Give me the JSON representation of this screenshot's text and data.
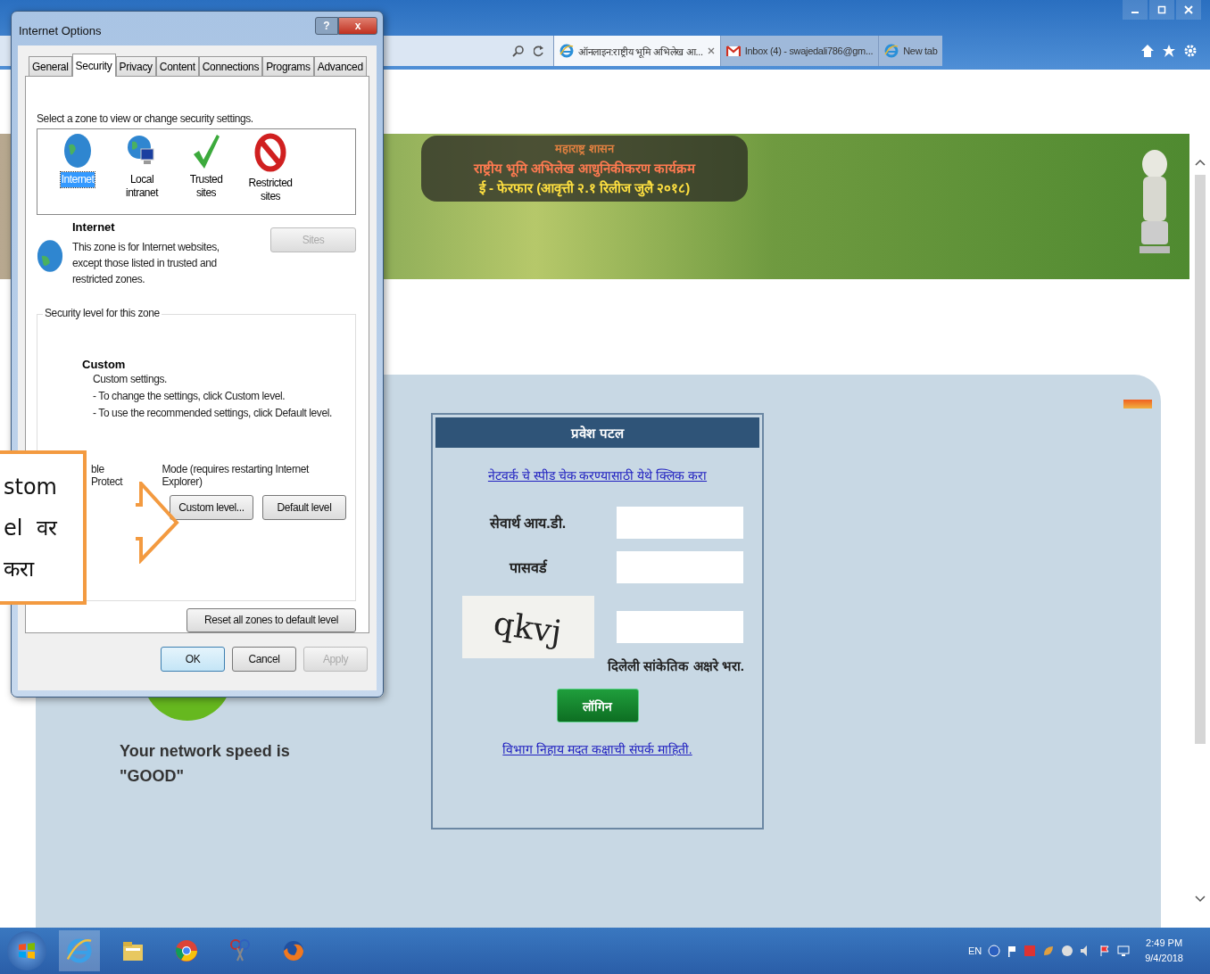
{
  "browser": {
    "tabs": [
      {
        "label": "ऑनलाइन:राष्ट्रीय भूमि अभिलेख आ...",
        "selected": true,
        "kind": "ie",
        "closable": true
      },
      {
        "label": "Inbox (4) - swajedali786@gm...",
        "selected": false,
        "kind": "mail",
        "closable": false
      },
      {
        "label": "New tab",
        "selected": false,
        "kind": "ie",
        "closable": false
      }
    ]
  },
  "banner": {
    "lines": [
      "महाराष्ट्र शासन",
      "राष्ट्रीय भूमि अभिलेख आधुनिकीकरण कार्यक्रम",
      "ई - फेरफार (आवृत्ती २.१ रिलीज जुलै २०१८)"
    ]
  },
  "speed_widget": {
    "lines": [
      "Your network speed is",
      "\"GOOD\""
    ]
  },
  "login": {
    "title": "प्रवेश पटल",
    "speed_link": "नेटवर्क चे स्पीड चेक करण्यासाठी येथे क्लिक करा",
    "fields": [
      {
        "kind": "text",
        "label": "सेवार्थ आय.डी."
      },
      {
        "kind": "password",
        "label": "पासवर्ड"
      },
      {
        "kind": "captcha",
        "label": "qkvj"
      }
    ],
    "captcha_hint": "दिलेली सांकेतिक अक्षरे भरा.",
    "button": "लॉगिन",
    "help_link": "विभाग निहाय मदत कक्षाची संपर्क माहिती."
  },
  "dialog": {
    "title": "Internet Options",
    "help": "?",
    "close": "x",
    "tabs": [
      {
        "label": "General",
        "selected": false
      },
      {
        "label": "Security",
        "selected": true
      },
      {
        "label": "Privacy",
        "selected": false
      },
      {
        "label": "Content",
        "selected": false
      },
      {
        "label": "Connections",
        "selected": false
      },
      {
        "label": "Programs",
        "selected": false
      },
      {
        "label": "Advanced",
        "selected": false
      }
    ],
    "zone_prompt": "Select a zone to view or change security settings.",
    "zones": [
      {
        "label": "Internet",
        "kind": "internet",
        "selected": true
      },
      {
        "label": "Local intranet",
        "kind": "intranet",
        "selected": false
      },
      {
        "label": "Trusted sites",
        "kind": "trusted",
        "selected": false
      },
      {
        "label": "Restricted sites",
        "kind": "restricted",
        "selected": false
      }
    ],
    "zone_name": "Internet",
    "zone_description": "This zone is for Internet websites, except those listed in trusted and restricted zones.",
    "sites_button": {
      "label": "Sites",
      "disabled": true
    },
    "group_title": "Security level for this zone",
    "level_name": "Custom",
    "level_lines": [
      "Custom settings.",
      "- To change the settings, click Custom level.",
      "- To use the recommended settings, click Default level."
    ],
    "protected_mode": [
      "ble Protect",
      "Mode (requires restarting Internet Explorer)"
    ],
    "level_buttons": [
      "Custom level...",
      "Default level"
    ],
    "reset_button": "Reset all zones to default level",
    "footer_buttons": [
      {
        "label": "OK",
        "disabled": false,
        "default": true
      },
      {
        "label": "Cancel",
        "disabled": false,
        "default": false
      },
      {
        "label": "Apply",
        "disabled": true,
        "default": false
      }
    ]
  },
  "callout": {
    "lines": [
      "stom",
      "el  वर",
      "करा"
    ]
  },
  "taskbar": {
    "language": "EN",
    "time": "2:49 PM",
    "date": "9/4/2018"
  }
}
